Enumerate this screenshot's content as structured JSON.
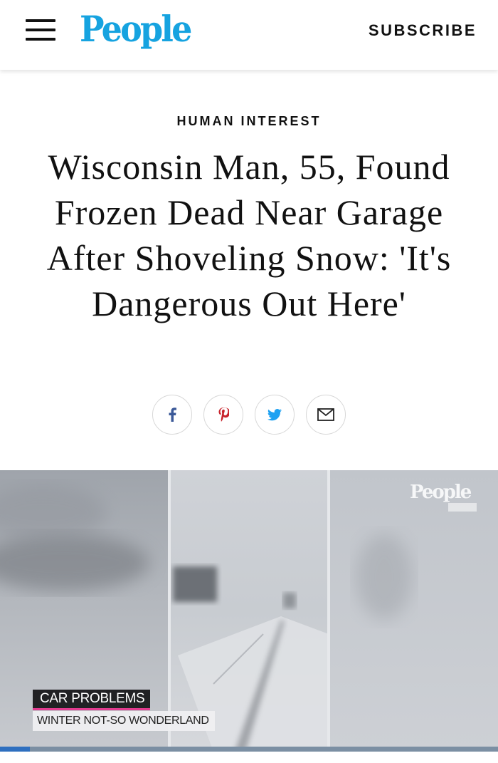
{
  "header": {
    "logo": "People",
    "subscribe_label": "SUBSCRIBE",
    "brand_color": "#16a3e0"
  },
  "article": {
    "kicker": "HUMAN INTEREST",
    "headline": "Wisconsin Man, 55, Found Frozen Dead Near Garage After Shoveling Snow: 'It's Dangerous Out Here'"
  },
  "share": {
    "icons": [
      "facebook-icon",
      "pinterest-icon",
      "twitter-icon",
      "email-icon"
    ]
  },
  "video": {
    "watermark": "People",
    "lower_third_title": "CAR PROBLEMS",
    "lower_third_subtitle": "WINTER NOT-SO WONDERLAND",
    "progress_fraction": 0.06
  }
}
